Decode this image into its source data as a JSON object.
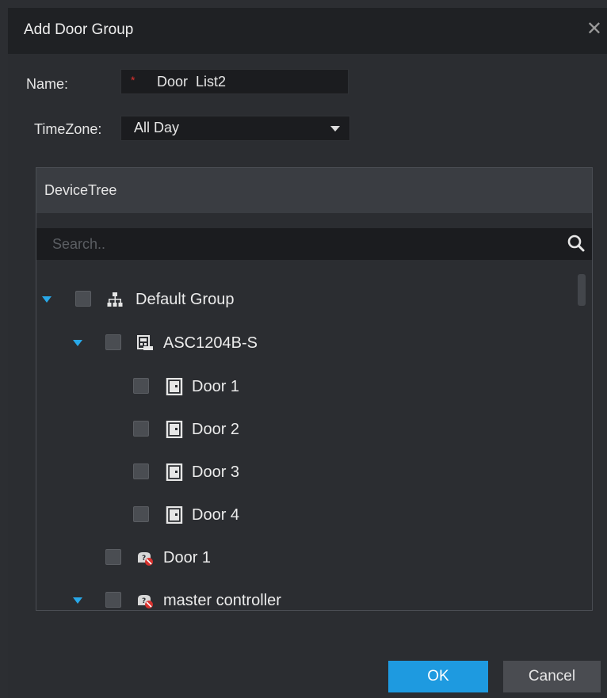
{
  "dialog": {
    "title": "Add Door Group",
    "close_label": "✕"
  },
  "form": {
    "name_label": "Name:",
    "name_required_mark": "*",
    "name_value": "Door  List2",
    "timezone_label": "TimeZone:",
    "timezone_value": "All Day"
  },
  "tree": {
    "header": "DeviceTree",
    "search_placeholder": "Search..",
    "rows": [
      {
        "label": "Default Group",
        "icon": "group-tree-icon"
      },
      {
        "label": "ASC1204B-S",
        "icon": "access-controller-icon"
      },
      {
        "label": "Door 1",
        "icon": "door-icon"
      },
      {
        "label": "Door 2",
        "icon": "door-icon"
      },
      {
        "label": "Door 3",
        "icon": "door-icon"
      },
      {
        "label": "Door 4",
        "icon": "door-icon"
      },
      {
        "label": "Door 1",
        "icon": "offline-device-icon"
      },
      {
        "label": "master controller",
        "icon": "offline-device-icon"
      }
    ]
  },
  "buttons": {
    "ok": "OK",
    "cancel": "Cancel"
  },
  "colors": {
    "accent": "#1e9ae0",
    "expander": "#28a8e8",
    "required": "#e0322f"
  }
}
